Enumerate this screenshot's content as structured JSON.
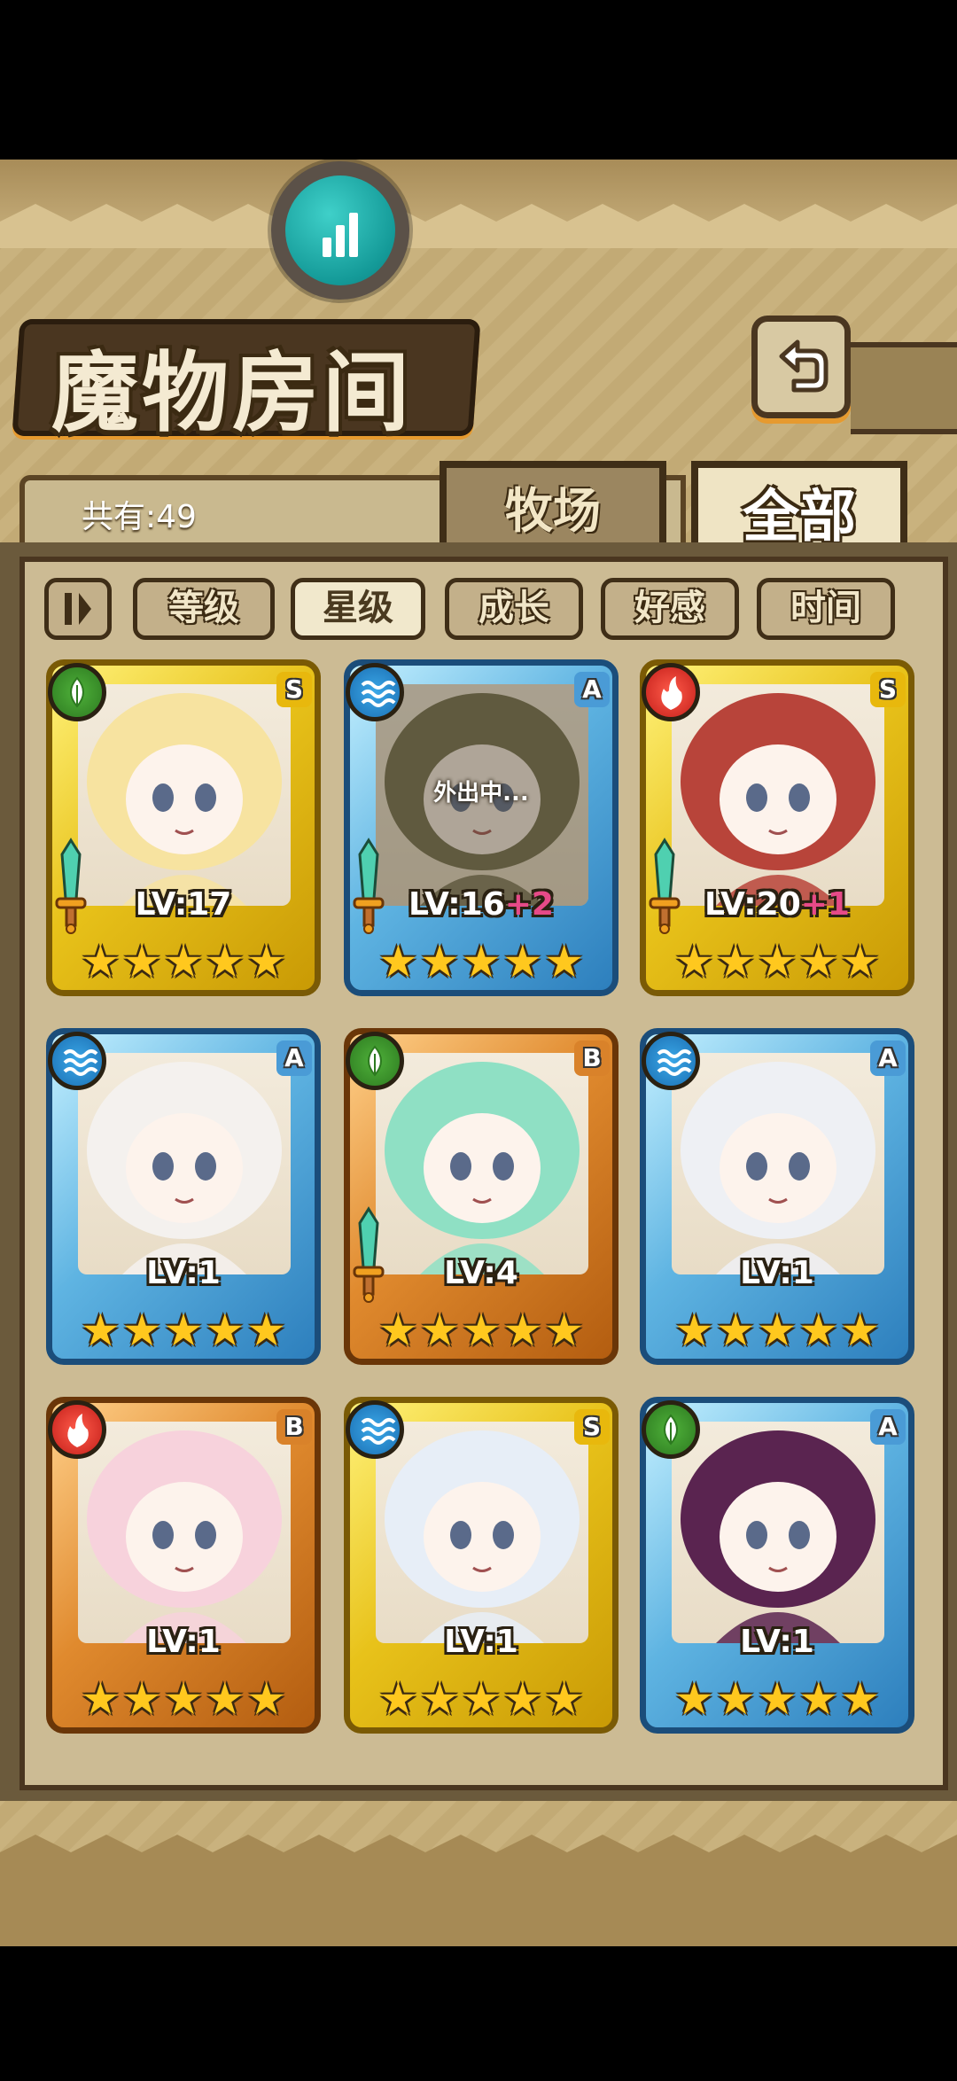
{
  "header": {
    "title": "魔物房间",
    "stats_icon": "bar-chart-icon",
    "return_icon": "return-arrow-icon"
  },
  "summary": {
    "count_text": "共有:49"
  },
  "tabs": [
    {
      "label": "牧场",
      "active": false
    },
    {
      "label": "全部",
      "active": true
    }
  ],
  "sort": {
    "order_icon": "sort-order-icon",
    "options": [
      {
        "label": "等级",
        "active": false
      },
      {
        "label": "星级",
        "active": true
      },
      {
        "label": "成长",
        "active": false
      },
      {
        "label": "好感",
        "active": false
      },
      {
        "label": "时间",
        "active": false
      }
    ]
  },
  "colors": {
    "leaf": "#3a9a2c",
    "water": "#2a8ad0",
    "fire": "#e0332a",
    "gold_frame": "#e8c21a",
    "blue_frame": "#5fb4e2",
    "bronze_frame": "#e08a2e",
    "plus_text": "#e64a88"
  },
  "monsters": [
    {
      "element": "leaf",
      "rank": "S",
      "level": "LV:17",
      "plus": "",
      "stars": 5,
      "status": "",
      "equipped": true,
      "hair": "#f7e3a0",
      "frame": "gold"
    },
    {
      "element": "water",
      "rank": "A",
      "level": "LV:16",
      "plus": "+2",
      "stars": 5,
      "status": "外出中...",
      "equipped": true,
      "hair": "#6d6a4a",
      "frame": "blue"
    },
    {
      "element": "fire",
      "rank": "S",
      "level": "LV:20",
      "plus": "+1",
      "stars": 5,
      "status": "",
      "equipped": true,
      "hair": "#b8443a",
      "frame": "gold"
    },
    {
      "element": "water",
      "rank": "A",
      "level": "LV:1",
      "plus": "",
      "stars": 5,
      "status": "",
      "equipped": false,
      "hair": "#f4f1ee",
      "frame": "blue"
    },
    {
      "element": "leaf",
      "rank": "B",
      "level": "LV:4",
      "plus": "",
      "stars": 5,
      "status": "",
      "equipped": true,
      "hair": "#8fe0c4",
      "frame": "bronze"
    },
    {
      "element": "water",
      "rank": "A",
      "level": "LV:1",
      "plus": "",
      "stars": 5,
      "status": "",
      "equipped": false,
      "hair": "#eef0f4",
      "frame": "blue"
    },
    {
      "element": "fire",
      "rank": "B",
      "level": "LV:1",
      "plus": "",
      "stars": 5,
      "status": "",
      "equipped": false,
      "hair": "#f7d2dc",
      "frame": "bronze"
    },
    {
      "element": "water",
      "rank": "S",
      "level": "LV:1",
      "plus": "",
      "stars": 5,
      "status": "",
      "equipped": false,
      "hair": "#e7eef7",
      "frame": "gold"
    },
    {
      "element": "leaf",
      "rank": "A",
      "level": "LV:1",
      "plus": "",
      "stars": 5,
      "status": "",
      "equipped": false,
      "hair": "#5a2450",
      "frame": "blue"
    }
  ]
}
